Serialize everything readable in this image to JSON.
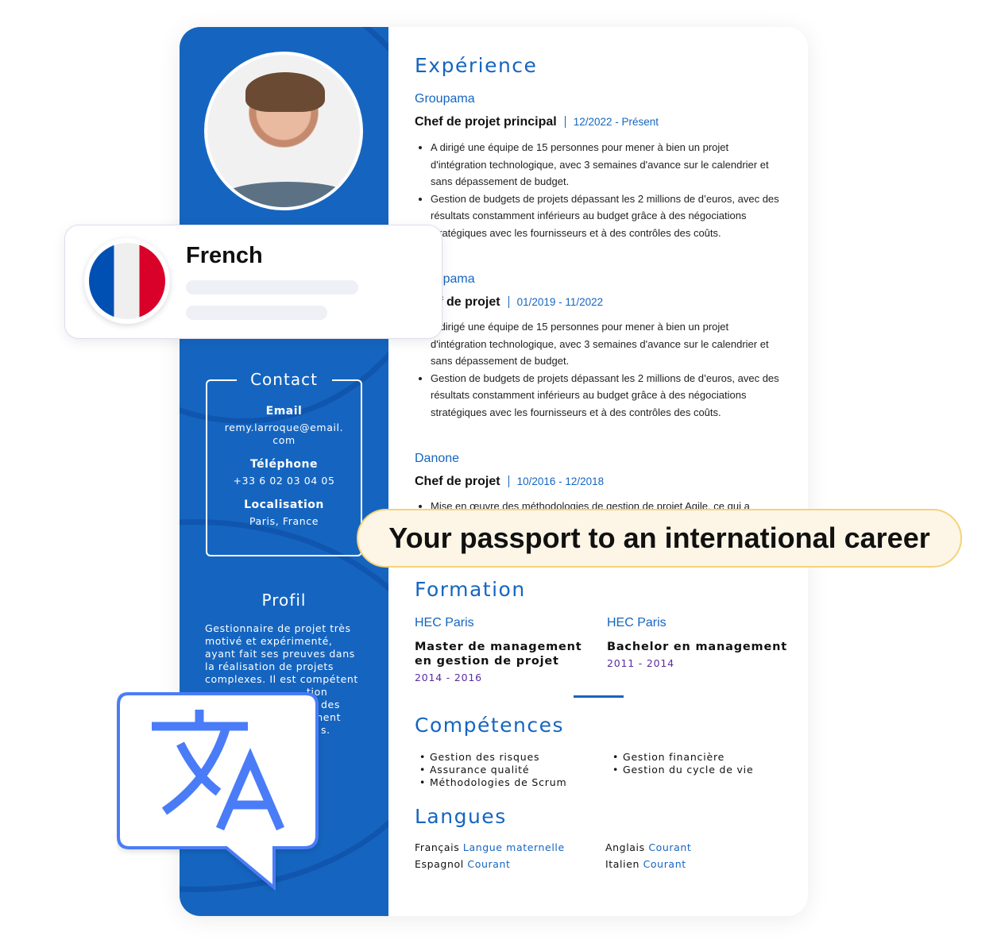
{
  "sidebar": {
    "contact": {
      "title": "Contact",
      "email_label": "Email",
      "email": "remy.larroque@email.com",
      "email_l1": "remy.larroque@email.",
      "email_l2": "com",
      "phone_label": "Téléphone",
      "phone": "+33 6 02 03 04 05",
      "location_label": "Localisation",
      "location": "Paris, France"
    },
    "profil": {
      "title": "Profil",
      "lines": [
        "Gestionnaire de projet très",
        "motivé et expérimenté,",
        "ayant fait ses preuves dans",
        "la réalisation de projets",
        "complexes. Il est compétent",
        "tion",
        "des",
        "ment",
        "s."
      ]
    }
  },
  "experience": {
    "title": "Expérience",
    "jobs": [
      {
        "company": "Groupama",
        "role": "Chef de projet principal",
        "dates": "12/2022 - Présent",
        "bullets": [
          "A dirigé une équipe de 15 personnes pour mener à bien un projet d'intégration technologique, avec 3 semaines d'avance sur le calendrier et sans dépassement de budget.",
          "Gestion de budgets de projets dépassant les 2 millions de d’euros, avec des résultats constamment inférieurs au budget grâce à des négociations stratégiques avec les fournisseurs et à des contrôles des coûts."
        ]
      },
      {
        "company": "Groupama",
        "role": "Chef de projet",
        "dates": "01/2019 - 11/2022",
        "bullets": [
          "A dirigé une équipe de 15 personnes pour mener à bien un projet d'intégration technologique, avec 3 semaines d'avance sur le calendrier et sans dépassement de budget.",
          "Gestion de budgets de projets dépassant les 2 millions de d’euros, avec des résultats constamment inférieurs au budget grâce à des négociations stratégiques avec les fournisseurs et à des contrôles des coûts."
        ]
      },
      {
        "company": "Danone",
        "role": "Chef de projet",
        "dates": "10/2016 - 12/2018",
        "bullets": [
          "Mise en œuvre des méthodologies de gestion de projet Agile, ce qui a"
        ]
      }
    ]
  },
  "formation": {
    "title": "Formation",
    "items": [
      {
        "school": "HEC Paris",
        "degree": "Master de management en gestion de projet",
        "years": "2014 - 2016"
      },
      {
        "school": "HEC Paris",
        "degree": "Bachelor en management",
        "years": "2011 - 2014"
      }
    ]
  },
  "competences": {
    "title": "Compétences",
    "col1": [
      "Gestion des risques",
      "Assurance qualité",
      "Méthodologies de Scrum"
    ],
    "col2": [
      "Gestion financière",
      "Gestion du cycle de vie"
    ]
  },
  "langues": {
    "title": "Langues",
    "items": [
      {
        "lang": "Français",
        "level": "Langue maternelle"
      },
      {
        "lang": "Anglais",
        "level": "Courant"
      },
      {
        "lang": "Espagnol",
        "level": "Courant"
      },
      {
        "lang": "Italien",
        "level": "Courant"
      }
    ]
  },
  "language_card": {
    "name": "French",
    "flag": "france-flag-icon"
  },
  "banner": {
    "text": "Your passport to an international career"
  },
  "translate_icon": "translate-icon",
  "colors": {
    "primary": "#1565c0",
    "banner_bg": "#fdf5e6",
    "banner_border": "#f5d27a",
    "translate": "#4a7cf7",
    "years": "#5b2aa0"
  }
}
